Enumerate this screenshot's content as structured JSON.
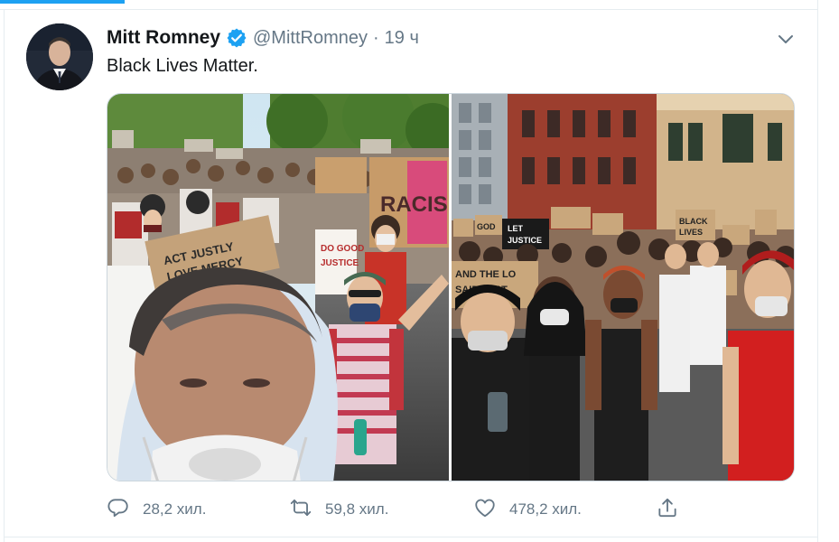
{
  "tweet": {
    "author_name": "Mitt Romney",
    "handle": "@MittRomney",
    "separator": "·",
    "time": "19 ч",
    "text": "Black Lives Matter.",
    "photos": [
      {
        "signs": [
          "RACISM",
          "ACT JUSTLY LOVE MERCY WALK",
          "DO GOOD SEEK JUSTICE"
        ]
      },
      {
        "signs": [
          "LET JUSTICE ROLL",
          "GOD",
          "BLACK LIVES",
          "AND THE LORD SAID THAT RE",
          "JUSTICE",
          "JUSTICE",
          "JUSTICE",
          "LACK LIVES"
        ]
      }
    ],
    "actions": {
      "reply_count": "28,2 хил.",
      "retweet_count": "59,8 хил.",
      "like_count": "478,2 хил."
    }
  },
  "colors": {
    "accent": "#1da1f2",
    "verified": "#1da1f2",
    "text_primary": "#14171a",
    "text_secondary": "#657786"
  },
  "icons": {
    "verified": "verified-badge-icon",
    "caret": "chevron-down-icon",
    "reply": "reply-bubble-icon",
    "retweet": "retweet-icon",
    "like": "heart-icon",
    "share": "share-upload-icon"
  }
}
